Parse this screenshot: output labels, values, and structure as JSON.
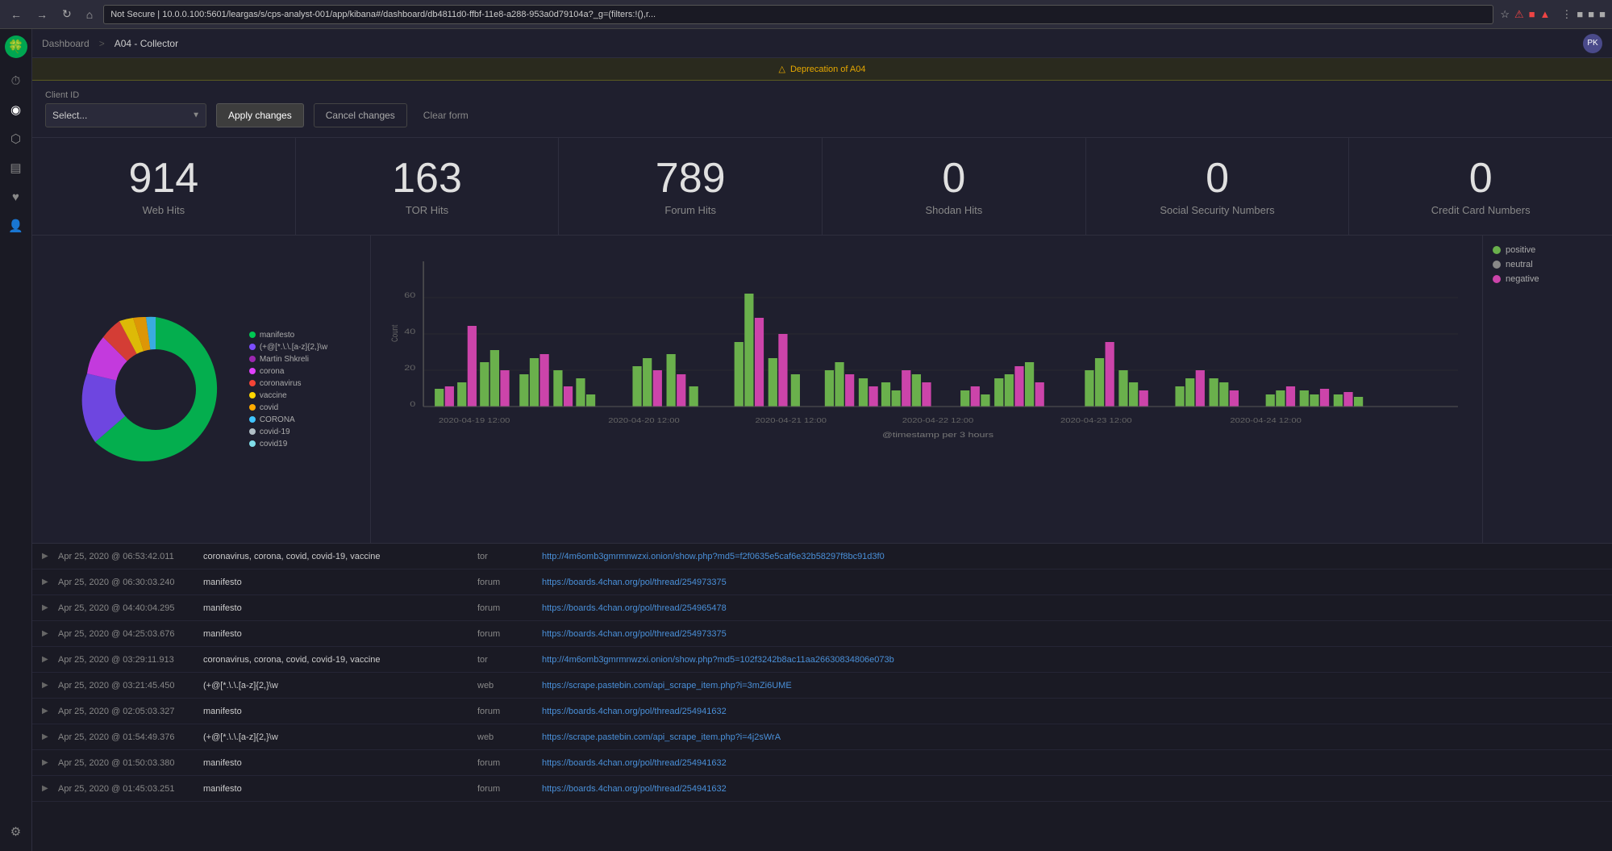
{
  "browser": {
    "url": "Not Secure | 10.0.0.100:5601/leargas/s/cps-analyst-001/app/kibana#/dashboard/db4811d0-ffbf-11e8-a288-953a0d79104a?_g=(filters:!(),r...",
    "secure_icon": "⚠",
    "favicon": "🍀"
  },
  "header": {
    "breadcrumbs": [
      "Dashboard",
      "A04 - Collector"
    ],
    "avatar_initials": "PK"
  },
  "warning": {
    "icon": "⚠",
    "text": "Deprecation of A04"
  },
  "filter": {
    "client_id_label": "Client ID",
    "select_placeholder": "Select...",
    "apply_label": "Apply changes",
    "cancel_label": "Cancel changes",
    "clear_label": "Clear form"
  },
  "stats": [
    {
      "value": "914",
      "label": "Web Hits"
    },
    {
      "value": "163",
      "label": "TOR Hits"
    },
    {
      "value": "789",
      "label": "Forum Hits"
    },
    {
      "value": "0",
      "label": "Shodan Hits"
    },
    {
      "value": "0",
      "label": "Social Security Numbers"
    },
    {
      "value": "0",
      "label": "Credit Card Numbers"
    }
  ],
  "donut_legend": [
    {
      "label": "manifesto",
      "color": "#00c853"
    },
    {
      "label": "(+@[*.\\.\\.[a-z]{2,}\\w",
      "color": "#7c4dff"
    },
    {
      "label": "Martin Shkreli",
      "color": "#9c27b0"
    },
    {
      "label": "corona",
      "color": "#e040fb"
    },
    {
      "label": "coronavirus",
      "color": "#f44336"
    },
    {
      "label": "vaccine",
      "color": "#ffd600"
    },
    {
      "label": "covid",
      "color": "#ffab00"
    },
    {
      "label": "CORONA",
      "color": "#40c4ff"
    },
    {
      "label": "covid-19",
      "color": "#b0bec5"
    },
    {
      "label": "covid19",
      "color": "#80deea"
    }
  ],
  "bar_chart": {
    "x_label": "@timestamp per 3 hours",
    "y_ticks": [
      "0",
      "20",
      "40",
      "60"
    ],
    "x_labels": [
      "2020-04-19 12:00",
      "2020-04-20 12:00",
      "2020-04-21 12:00",
      "2020-04-22 12:00",
      "2020-04-23 12:00",
      "2020-04-24 12:00"
    ]
  },
  "chart_legend": [
    {
      "label": "positive",
      "color": "#6ab04c"
    },
    {
      "label": "neutral",
      "color": "#888888"
    },
    {
      "label": "negative",
      "color": "#cc44aa"
    }
  ],
  "table": {
    "rows": [
      {
        "timestamp": "Apr 25, 2020 @ 06:53:42.011",
        "tags": "coronavirus, corona, covid, covid-19, vaccine",
        "source": "tor",
        "url": "http://4m6omb3gmrmnwzxi.onion/show.php?md5=f2f0635e5caf6e32b58297f8bc91d3f0"
      },
      {
        "timestamp": "Apr 25, 2020 @ 06:30:03.240",
        "tags": "manifesto",
        "source": "forum",
        "url": "https://boards.4chan.org/pol/thread/254973375"
      },
      {
        "timestamp": "Apr 25, 2020 @ 04:40:04.295",
        "tags": "manifesto",
        "source": "forum",
        "url": "https://boards.4chan.org/pol/thread/254965478"
      },
      {
        "timestamp": "Apr 25, 2020 @ 04:25:03.676",
        "tags": "manifesto",
        "source": "forum",
        "url": "https://boards.4chan.org/pol/thread/254973375"
      },
      {
        "timestamp": "Apr 25, 2020 @ 03:29:11.913",
        "tags": "coronavirus, corona, covid, covid-19, vaccine",
        "source": "tor",
        "url": "http://4m6omb3gmrmnwzxi.onion/show.php?md5=102f3242b8ac11aa26630834806e073b"
      },
      {
        "timestamp": "Apr 25, 2020 @ 03:21:45.450",
        "tags": "(+@[*.\\.\\.[a-z]{2,}\\w",
        "source": "web",
        "url": "https://scrape.pastebin.com/api_scrape_item.php?i=3mZi6UME"
      },
      {
        "timestamp": "Apr 25, 2020 @ 02:05:03.327",
        "tags": "manifesto",
        "source": "forum",
        "url": "https://boards.4chan.org/pol/thread/254941632"
      },
      {
        "timestamp": "Apr 25, 2020 @ 01:54:49.376",
        "tags": "(+@[*.\\.\\.[a-z]{2,}\\w",
        "source": "web",
        "url": "https://scrape.pastebin.com/api_scrape_item.php?i=4j2sWrA"
      },
      {
        "timestamp": "Apr 25, 2020 @ 01:50:03.380",
        "tags": "manifesto",
        "source": "forum",
        "url": "https://boards.4chan.org/pol/thread/254941632"
      },
      {
        "timestamp": "Apr 25, 2020 @ 01:45:03.251",
        "tags": "manifesto",
        "source": "forum",
        "url": "https://boards.4chan.org/pol/thread/254941632"
      }
    ]
  },
  "sidebar": {
    "logo": "🍀",
    "items": [
      {
        "icon": "⏱",
        "name": "clock"
      },
      {
        "icon": "◎",
        "name": "circle"
      },
      {
        "icon": "⬡",
        "name": "grid"
      },
      {
        "icon": "▤",
        "name": "table"
      },
      {
        "icon": "♥",
        "name": "heart"
      },
      {
        "icon": "💡",
        "name": "light"
      },
      {
        "icon": "⚙",
        "name": "settings"
      }
    ]
  }
}
